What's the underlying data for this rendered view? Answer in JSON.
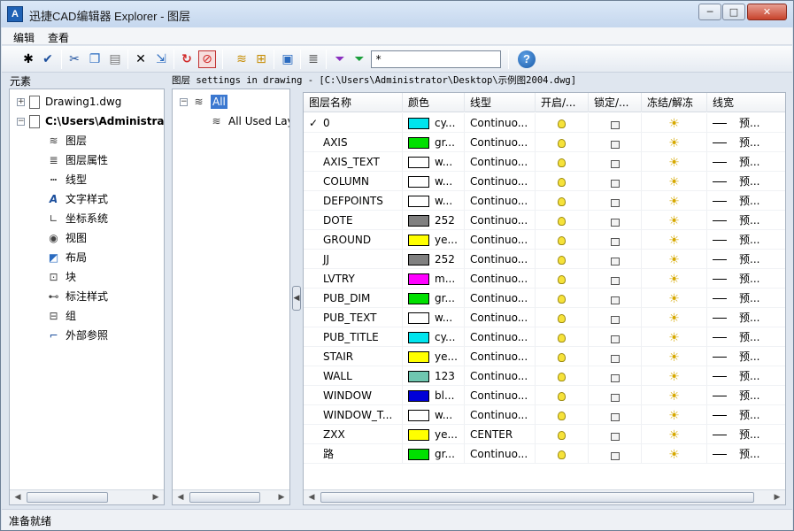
{
  "window": {
    "title": "迅捷CAD编辑器 Explorer - 图层",
    "app_icon_letter": "A",
    "minimize": "─",
    "maximize": "□",
    "close": "✕"
  },
  "menu": [
    "编辑",
    "查看"
  ],
  "toolbar": {
    "filter_value": "*",
    "help": "?"
  },
  "left_panel": {
    "label": "元素",
    "items": [
      {
        "label": "Drawing1.dwg",
        "icon": "document-icon"
      },
      {
        "label": "C:\\Users\\Administrat",
        "icon": "document-icon"
      },
      {
        "label": "图层",
        "icon": "layers-icon"
      },
      {
        "label": "图层属性",
        "icon": "layer-properties-icon"
      },
      {
        "label": "线型",
        "icon": "linetype-icon"
      },
      {
        "label": "文字样式",
        "icon": "text-style-icon"
      },
      {
        "label": "坐标系统",
        "icon": "ucs-icon"
      },
      {
        "label": "视图",
        "icon": "view-eye-icon"
      },
      {
        "label": "布局",
        "icon": "layout-icon"
      },
      {
        "label": "块",
        "icon": "block-icon"
      },
      {
        "label": "标注样式",
        "icon": "dimension-style-icon"
      },
      {
        "label": "组",
        "icon": "group-icon"
      },
      {
        "label": "外部参照",
        "icon": "xref-icon"
      }
    ]
  },
  "header_path": "图层 settings in drawing - [C:\\Users\\Administrator\\Desktop\\示例图2004.dwg]",
  "mid_panel": {
    "items": [
      {
        "label": "All"
      },
      {
        "label": "All Used Lay"
      }
    ]
  },
  "grid": {
    "columns": [
      "图层名称",
      "颜色",
      "线型",
      "开启/...",
      "锁定/...",
      "冻结/解冻",
      "线宽"
    ],
    "rows": [
      {
        "name": "0",
        "color": "#00e5ee",
        "color_label": "cy...",
        "linetype": "Continuo...",
        "lineweight": "预...",
        "current": "✓"
      },
      {
        "name": "AXIS",
        "color": "#00e000",
        "color_label": "gr...",
        "linetype": "Continuo...",
        "lineweight": "预...",
        "current": ""
      },
      {
        "name": "AXIS_TEXT",
        "color": "#ffffff",
        "color_label": "w...",
        "linetype": "Continuo...",
        "lineweight": "预...",
        "current": ""
      },
      {
        "name": "COLUMN",
        "color": "#ffffff",
        "color_label": "w...",
        "linetype": "Continuo...",
        "lineweight": "预...",
        "current": ""
      },
      {
        "name": "DEFPOINTS",
        "color": "#ffffff",
        "color_label": "w...",
        "linetype": "Continuo...",
        "lineweight": "预...",
        "current": ""
      },
      {
        "name": "DOTE",
        "color": "#808080",
        "color_label": "252",
        "linetype": "Continuo...",
        "lineweight": "预...",
        "current": ""
      },
      {
        "name": "GROUND",
        "color": "#ffff00",
        "color_label": "ye...",
        "linetype": "Continuo...",
        "lineweight": "预...",
        "current": ""
      },
      {
        "name": "JJ",
        "color": "#808080",
        "color_label": "252",
        "linetype": "Continuo...",
        "lineweight": "预...",
        "current": ""
      },
      {
        "name": "LVTRY",
        "color": "#ff00ff",
        "color_label": "m...",
        "linetype": "Continuo...",
        "lineweight": "预...",
        "current": ""
      },
      {
        "name": "PUB_DIM",
        "color": "#00e000",
        "color_label": "gr...",
        "linetype": "Continuo...",
        "lineweight": "预...",
        "current": ""
      },
      {
        "name": "PUB_TEXT",
        "color": "#ffffff",
        "color_label": "w...",
        "linetype": "Continuo...",
        "lineweight": "预...",
        "current": ""
      },
      {
        "name": "PUB_TITLE",
        "color": "#00e5ee",
        "color_label": "cy...",
        "linetype": "Continuo...",
        "lineweight": "预...",
        "current": ""
      },
      {
        "name": "STAIR",
        "color": "#ffff00",
        "color_label": "ye...",
        "linetype": "Continuo...",
        "lineweight": "预...",
        "current": ""
      },
      {
        "name": "WALL",
        "color": "#6fc7b0",
        "color_label": "123",
        "linetype": "Continuo...",
        "lineweight": "预...",
        "current": ""
      },
      {
        "name": "WINDOW",
        "color": "#0000d8",
        "color_label": "bl...",
        "linetype": "Continuo...",
        "lineweight": "预...",
        "current": ""
      },
      {
        "name": "WINDOW_T...",
        "color": "#ffffff",
        "color_label": "w...",
        "linetype": "Continuo...",
        "lineweight": "预...",
        "current": ""
      },
      {
        "name": "ZXX",
        "color": "#ffff00",
        "color_label": "ye...",
        "linetype": "CENTER",
        "lineweight": "预...",
        "current": ""
      },
      {
        "name": "路",
        "color": "#00e000",
        "color_label": "gr...",
        "linetype": "Continuo...",
        "lineweight": "预...",
        "current": ""
      }
    ]
  },
  "status": "准备就绪"
}
